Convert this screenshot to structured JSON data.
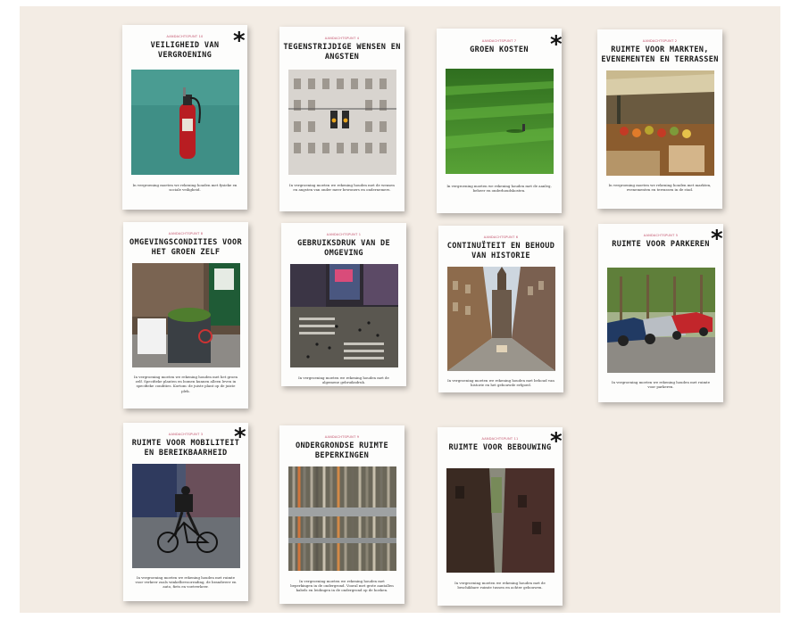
{
  "cards": [
    {
      "category": "AANDACHTSPUNT 10",
      "title": "VEILIGHEID VAN VERGROENING",
      "starred": true,
      "body": "In vergroening moeten we rekening houden met fysieke en sociale veiligheid.",
      "image": "fire-extinguisher"
    },
    {
      "category": "AANDACHTSPUNT 4",
      "title": "TEGENSTRIJDIGE WENSEN EN ANGSTEN",
      "starred": false,
      "body": "In vergroening moeten we rekening houden met de wensen en angsten van onder meer bewoners en ondernemers.",
      "image": "traffic-light-building"
    },
    {
      "category": "AANDACHTSPUNT 7",
      "title": "GROEN KOSTEN",
      "starred": true,
      "body": "In vergroening moeten we rekening houden met de aanleg, beheer en onderhoudskosten.",
      "image": "lawn-mower"
    },
    {
      "category": "AANDACHTSPUNT 2",
      "title": "RUIMTE VOOR MARKTEN, EVENEMENTEN EN TERRASSEN",
      "starred": false,
      "body": "In vergroening moeten we rekening houden met markten, evenementen en terrassen in de stad.",
      "image": "market"
    },
    {
      "category": "AANDACHTSPUNT 8",
      "title": "OMGEVINGSCONDITIES VOOR HET GROEN ZELF",
      "starred": false,
      "body": "In vergroening moeten we rekening houden met het groen zelf. Specifieke planten en bomen kunnen alleen leven in specifieke condities. Kortom: de juiste plant op de juiste plek.",
      "image": "planters"
    },
    {
      "category": "AANDACHTSPUNT 1",
      "title": "GEBRUIKSDRUK VAN DE OMGEVING",
      "starred": false,
      "body": "In vergroening moeten we rekening houden met de algemene gebruiksdruk.",
      "image": "crossing"
    },
    {
      "category": "AANDACHTSPUNT 6",
      "title": "CONTINUÏTEIT EN BEHOUD VAN HISTORIE",
      "starred": false,
      "body": "In vergroening moeten we rekening houden met behoud van historie en het gebouwde erfgoed.",
      "image": "historic-street"
    },
    {
      "category": "AANDACHTSPUNT 5",
      "title": "RUIMTE VOOR PARKEREN",
      "starred": true,
      "body": "In vergroening moeten we rekening houden met ruimte voor parkeren.",
      "image": "parked-cars"
    },
    {
      "category": "AANDACHTSPUNT 3",
      "title": "RUIMTE VOOR MOBILITEIT EN BEREIKBAARHEID",
      "starred": true,
      "body": "In vergroening moeten we rekening houden met ruimte voor verkeer zoals winkelbevoorrading, de brandweer en auto, fiets en voetverkeer.",
      "image": "cyclist"
    },
    {
      "category": "AANDACHTSPUNT 9",
      "title": "ONDERGRONDSE RUIMTE BEPERKINGEN",
      "starred": false,
      "body": "In vergroening moeten we rekening houden met beperkingen in de ondergrond. Vooral met grote aantallen kabels en leidingen in de ondergrond op de hoeken.",
      "image": "cables"
    },
    {
      "category": "AANDACHTSPUNT 11",
      "title": "RUIMTE VOOR BEBOUWING",
      "starred": true,
      "body": "In vergroening moeten we rekening houden met de beschikbare ruimte tussen en achter gebouwen.",
      "image": "alley"
    }
  ],
  "star_symbol": "*",
  "colors": {
    "board": "#f3ece4",
    "card": "#fdfdfc",
    "category": "#c2506a",
    "title": "#1a1a1a"
  }
}
